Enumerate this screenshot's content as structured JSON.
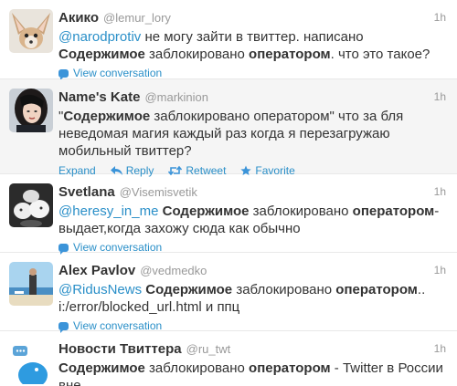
{
  "colors": {
    "link": "#2a8fc8",
    "muted": "#999999",
    "text": "#333333",
    "highlight_bg": "#f5f5f5"
  },
  "tweets": [
    {
      "name": "Акико",
      "handle": "@lemur_lory",
      "time": "1h",
      "mention": "@narodprotiv",
      "t1": " не могу зайти в твиттер. написано ",
      "b1": "Содержимое",
      "t2": " заблокировано ",
      "b2": "оператором",
      "t3": ". что это такое?",
      "view": "View conversation",
      "avatar_icon": "fennec-avatar-icon"
    },
    {
      "name": "Name's Kate",
      "handle": "@markinion",
      "time": "1h",
      "t0": "\"",
      "b1": "Содержимое",
      "t1": " заблокировано оператором\" что за бля неведомая магия каждый раз когда я перезагружаю мобильный твиттер?",
      "actions": {
        "expand": "Expand",
        "reply": "Reply",
        "retweet": "Retweet",
        "favorite": "Favorite"
      },
      "avatar_icon": "girl-avatar-icon"
    },
    {
      "name": "Svetlana",
      "handle": "@Visemisvetik",
      "time": "1h",
      "mention": "@heresy_in_me",
      "t1": " ",
      "b1": "Содержимое",
      "t2": " заблокировано ",
      "b2": "оператором",
      "t3": "-выдает,когда захожу сюда как обычно",
      "view": "View conversation",
      "avatar_icon": "cats-avatar-icon"
    },
    {
      "name": "Alex Pavlov",
      "handle": "@vedmedko",
      "time": "1h",
      "mention": "@RidusNews",
      "t1": " ",
      "b1": "Содержимое",
      "t2": " заблокировано ",
      "b2": "оператором",
      "t3": ".. i:/error/blocked_url.html и ппц",
      "view": "View conversation",
      "avatar_icon": "beach-avatar-icon"
    },
    {
      "name": "Новости Твиттера",
      "handle": "@ru_twt",
      "time": "1h",
      "b1": "Содержимое",
      "t1": " заблокировано ",
      "b2": "оператором",
      "t2": " - Twitter в России вне",
      "avatar_icon": "twitter-bird-avatar-icon"
    }
  ]
}
